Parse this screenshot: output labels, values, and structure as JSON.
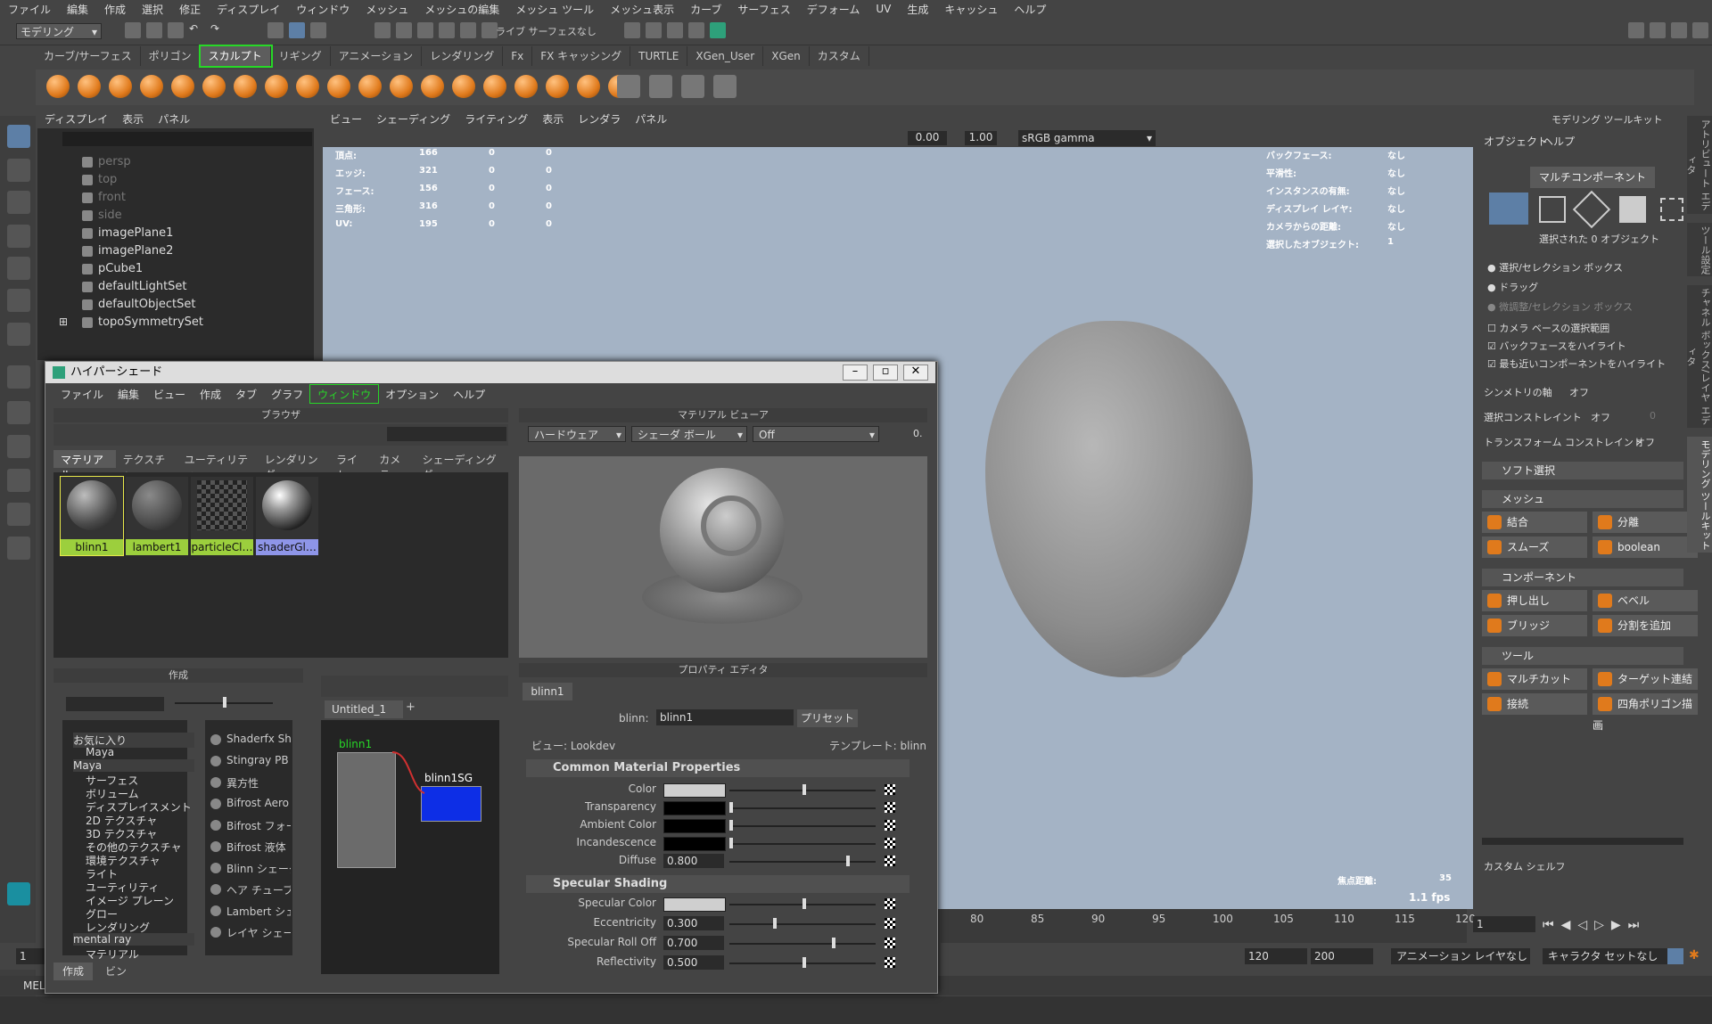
{
  "menubar": [
    "ファイル",
    "編集",
    "作成",
    "選択",
    "修正",
    "ディスプレイ",
    "ウィンドウ",
    "メッシュ",
    "メッシュの編集",
    "メッシュ ツール",
    "メッシュ表示",
    "カーブ",
    "サーフェス",
    "デフォーム",
    "UV",
    "生成",
    "キャッシュ",
    "ヘルプ"
  ],
  "status": {
    "mode": "モデリング",
    "live": "ライブ サーフェスなし"
  },
  "shelf_tabs": [
    "カーブ/サーフェス",
    "ポリゴン",
    "スカルプト",
    "リギング",
    "アニメーション",
    "レンダリング",
    "Fx",
    "FX キャッシング",
    "TURTLE",
    "XGen_User",
    "XGen",
    "カスタム"
  ],
  "shelf_selected": "スカルプト",
  "outliner": {
    "menu": [
      "ディスプレイ",
      "表示",
      "パネル"
    ],
    "items": [
      "persp",
      "top",
      "front",
      "side",
      "imagePlane1",
      "imagePlane2",
      "pCube1",
      "defaultLightSet",
      "defaultObjectSet",
      "topoSymmetrySet"
    ]
  },
  "viewport": {
    "menu": [
      "ビュー",
      "シェーディング",
      "ライティング",
      "表示",
      "レンダラ",
      "パネル"
    ],
    "field1": "0.00",
    "field2": "1.00",
    "colorspace": "sRGB gamma",
    "hud_left": [
      {
        "label": "頂点:",
        "v1": "166",
        "v2": "0",
        "v3": "0"
      },
      {
        "label": "エッジ:",
        "v1": "321",
        "v2": "0",
        "v3": "0"
      },
      {
        "label": "フェース:",
        "v1": "156",
        "v2": "0",
        "v3": "0"
      },
      {
        "label": "三角形:",
        "v1": "316",
        "v2": "0",
        "v3": "0"
      },
      {
        "label": "UV:",
        "v1": "195",
        "v2": "0",
        "v3": "0"
      }
    ],
    "hud_right": [
      {
        "label": "バックフェース:",
        "value": "なし"
      },
      {
        "label": "平滑性:",
        "value": "なし"
      },
      {
        "label": "インスタンスの有無:",
        "value": "なし"
      },
      {
        "label": "ディスプレイ レイヤ:",
        "value": "なし"
      },
      {
        "label": "カメラからの距離:",
        "value": "なし"
      },
      {
        "label": "選択したオブジェクト:",
        "value": "1"
      }
    ],
    "focal_label": "焦点距離:",
    "focal_value": "35",
    "fps": "1.1 fps"
  },
  "modeling_toolkit": {
    "title": "モデリング ツールキット",
    "menu": [
      "オブジェクト",
      "ヘルプ"
    ],
    "multi": "マルチコンポーネント",
    "selected_info": "選択された 0 オブジェクト",
    "radio1": "選択/セレクション ボックス",
    "radio2": "ドラッグ",
    "radio3": "微調整/セレクション ボックス",
    "check1": "カメラ ベースの選択範囲",
    "check2": "バックフェースをハイライト",
    "check3": "最も近いコンポーネントをハイライト",
    "symmetry_label": "シンメトリの軸",
    "symmetry_value": "オフ",
    "select_constraint": "選択コンストレイント",
    "select_constraint_value": "オフ",
    "select_constraint_num": "0",
    "transform_constraint": "トランスフォーム コンストレイント",
    "transform_constraint_value": "オフ",
    "soft_select": "ソフト選択",
    "sec_mesh": "メッシュ",
    "mesh_btns": [
      "結合",
      "分離",
      "スムーズ",
      "boolean"
    ],
    "sec_component": "コンポーネント",
    "comp_btns": [
      "押し出し",
      "ベベル",
      "ブリッジ",
      "分割を追加"
    ],
    "sec_tools": "ツール",
    "tool_btns": [
      "マルチカット",
      "ターゲット連結",
      "接続",
      "四角ポリゴン描画"
    ],
    "custom_shelf": "カスタム シェルフ",
    "vtabs": [
      "アトリビュート エディタ",
      "ツール設定",
      "チャネル ボックス/レイヤ エディタ",
      "モデリング ツールキット"
    ]
  },
  "timeline": {
    "ticks": [
      "80",
      "85",
      "90",
      "95",
      "100",
      "105",
      "110",
      "115",
      "120"
    ],
    "current": "1",
    "start": "1",
    "range_start": "1",
    "range_end": "120",
    "end": "200",
    "anim_layer": "アニメーション レイヤなし",
    "char_set": "キャラクタ セットなし"
  },
  "command_label": "MEL",
  "hypershade": {
    "title": "ハイパーシェード",
    "menu": [
      "ファイル",
      "編集",
      "ビュー",
      "作成",
      "タブ",
      "グラフ",
      "ウィンドウ",
      "オプション",
      "ヘルプ"
    ],
    "browser_title": "ブラウザ",
    "browser_tabs": [
      "マテリアル",
      "テクスチャ",
      "ユーティリティ",
      "レンダリング",
      "ライト",
      "カメラ",
      "シェーディング グ"
    ],
    "materials": [
      "blinn1",
      "lambert1",
      "particleCl…",
      "shaderGl…"
    ],
    "matview_title": "マテリアル ビューア",
    "matview_renderer": "ハードウェア",
    "matview_shape": "シェーダ ボール",
    "matview_env": "Off",
    "matview_num": "0.",
    "create_title": "作成",
    "create_list": [
      "お気に入り",
      "Maya",
      "Maya",
      "サーフェス",
      "ボリューム",
      "ディスプレイスメント",
      "2D テクスチャ",
      "3D テクスチャ",
      "その他のテクスチャ",
      "環境テクスチャ",
      "ライト",
      "ユーティリティ",
      "イメージ プレーン",
      "グロー",
      "レンダリング",
      "mental ray",
      "マテリアル"
    ],
    "node_list": [
      "Shaderfx Sh",
      "Stingray PB",
      "異方性",
      "Bifrost Aero",
      "Bifrost フォー",
      "Bifrost 液体",
      "Blinn シェーダ",
      "ヘア チューブシ",
      "Lambert シェ",
      "レイヤ シェーダ"
    ],
    "graph_tab": "Untitled_1",
    "graph_plus": "+",
    "node_blinn": "blinn1",
    "node_sg": "blinn1SG",
    "bottom_tabs": [
      "作成",
      "ビン"
    ],
    "prop_title": "プロパティ エディタ",
    "prop_tab": "blinn1",
    "prop_type_label": "blinn:",
    "prop_name": "blinn1",
    "preset": "プリセット",
    "view_label": "ビュー: Lookdev",
    "template_label": "テンプレート: blinn",
    "sec_common": "Common Material Properties",
    "common": [
      {
        "label": "Color",
        "type": "color",
        "value": "#cfcfcf",
        "level": 0.5
      },
      {
        "label": "Transparency",
        "type": "color",
        "value": "#000000",
        "level": 0.0
      },
      {
        "label": "Ambient Color",
        "type": "color",
        "value": "#000000",
        "level": 0.0
      },
      {
        "label": "Incandescence",
        "type": "color",
        "value": "#000000",
        "level": 0.0
      },
      {
        "label": "Diffuse",
        "type": "num",
        "value": "0.800",
        "level": 0.8
      }
    ],
    "sec_spec": "Specular Shading",
    "spec": [
      {
        "label": "Specular Color",
        "type": "color",
        "value": "#cfcfcf",
        "level": 0.5
      },
      {
        "label": "Eccentricity",
        "type": "num",
        "value": "0.300",
        "level": 0.3
      },
      {
        "label": "Specular Roll Off",
        "type": "num",
        "value": "0.700",
        "level": 0.7
      },
      {
        "label": "Reflectivity",
        "type": "num",
        "value": "0.500",
        "level": 0.5
      }
    ]
  }
}
